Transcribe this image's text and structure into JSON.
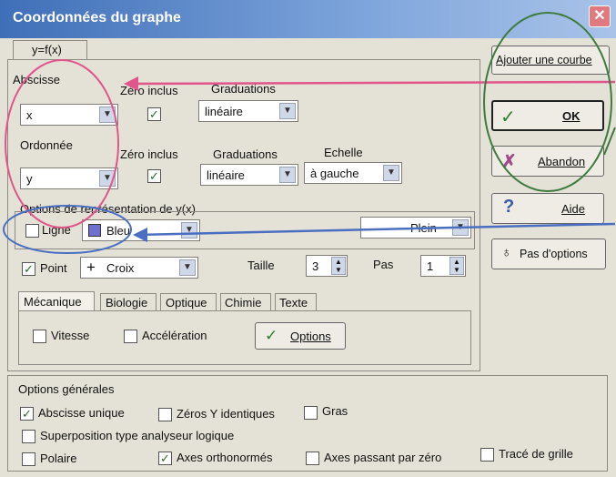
{
  "title": "Coordonnées du graphe",
  "tab_main": "y=f(x)",
  "abscisse": {
    "label": "Abscisse",
    "value": "x",
    "zero_label": "Zéro inclus",
    "grad_label": "Graduations",
    "grad_value": "linéaire"
  },
  "ordonnee": {
    "label": "Ordonnée",
    "value": "y",
    "zero_label": "Zéro inclus",
    "grad_label": "Graduations",
    "grad_value": "linéaire",
    "echelle_label": "Echelle",
    "echelle_value": "à gauche"
  },
  "representation": {
    "label": "Options de représentation de y(x)",
    "ligne_label": "Ligne",
    "color_value": "Bleu",
    "style_value": "Plein",
    "point_label": "Point",
    "point_value": "Croix",
    "taille_label": "Taille",
    "taille_value": "3",
    "pas_label": "Pas",
    "pas_value": "1"
  },
  "tabs": [
    "Mécanique",
    "Biologie",
    "Optique",
    "Chimie",
    "Texte"
  ],
  "mecanique": {
    "vitesse": "Vitesse",
    "acceleration": "Accélération",
    "options_button": "Options"
  },
  "generales": {
    "label": "Options générales",
    "abscisse_unique": "Abscisse unique",
    "zeros_y": "Zéros Y identiques",
    "gras": "Gras",
    "superposition": "Superposition type analyseur logique",
    "polaire": "Polaire",
    "axes_ortho": "Axes orthonormés",
    "axes_zero": "Axes passant par zéro",
    "trace_grille": "Tracé de grille"
  },
  "buttons": {
    "ajouter": "Ajouter une courbe",
    "ok": "OK",
    "abandon": "Abandon",
    "aide": "Aide",
    "pas_options": "Pas d'options"
  },
  "close_glyph": "✕",
  "check_glyph": "✓",
  "colors": {
    "pink_annotation": "#e0558a",
    "blue_annotation": "#4a6fc0",
    "green_annotation": "#3f7a3f",
    "swatch_blue": "#6f6fcf"
  }
}
